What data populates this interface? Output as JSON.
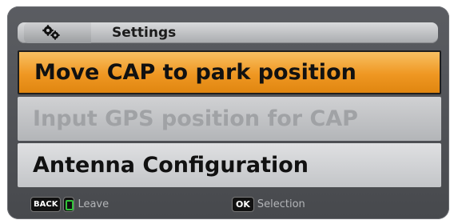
{
  "header": {
    "title": "Settings",
    "icon": "gears-icon"
  },
  "menu": {
    "items": [
      {
        "label": "Move CAP to park position",
        "state": "selected"
      },
      {
        "label": "Input GPS position for CAP",
        "state": "disabled"
      },
      {
        "label": "Antenna Configuration",
        "state": "normal"
      }
    ]
  },
  "footer": {
    "back_key": "BACK",
    "leave_label": "Leave",
    "ok_key": "OK",
    "selection_label": "Selection"
  },
  "colors": {
    "highlight": "#ef9722",
    "panel": "#4f5155",
    "hint_text": "#b3b5b8",
    "green_key": "#31c23a"
  }
}
